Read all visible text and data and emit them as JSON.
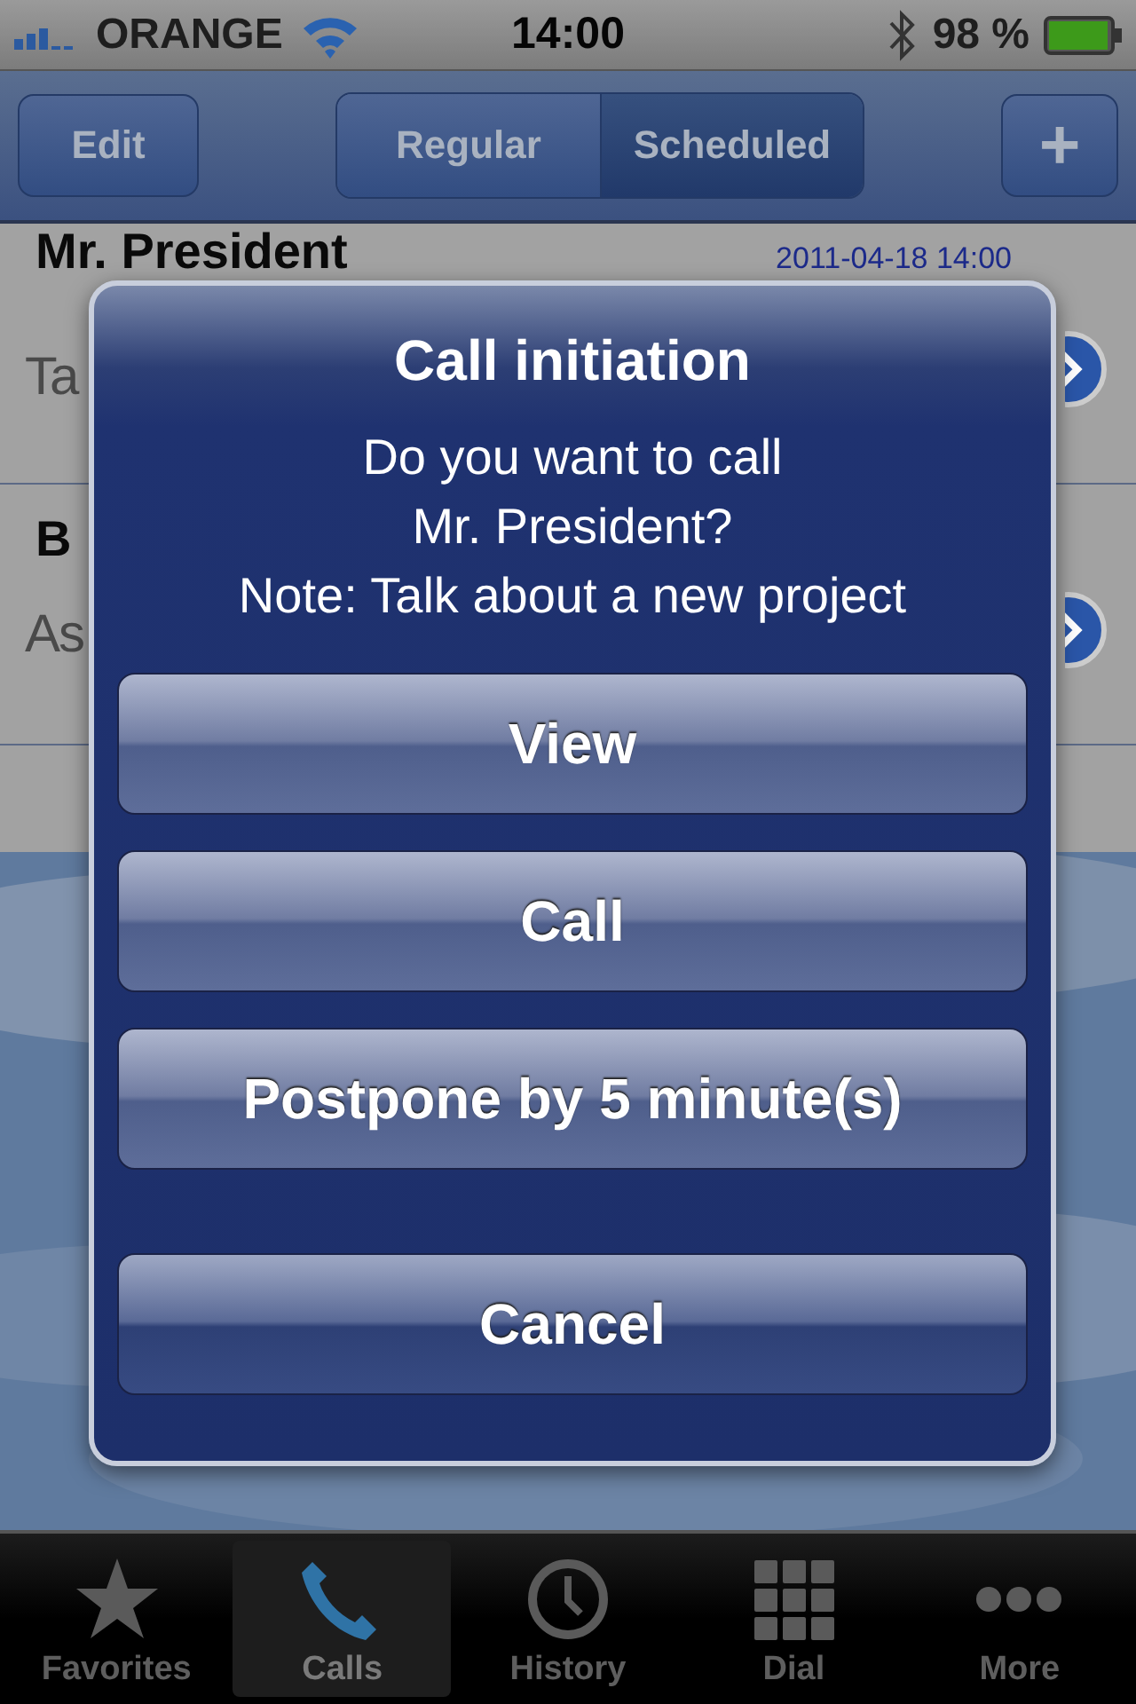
{
  "status_bar": {
    "carrier": "ORANGE",
    "time": "14:00",
    "battery": "98 %"
  },
  "nav_bar": {
    "edit": "Edit",
    "add": "+",
    "segments": [
      {
        "label": "Regular",
        "selected": false
      },
      {
        "label": "Scheduled",
        "selected": true
      }
    ]
  },
  "calls": [
    {
      "name": "Mr. President",
      "date": "2011-04-18 14:00",
      "note": "Ta"
    },
    {
      "name": "B",
      "note": "As"
    }
  ],
  "alert": {
    "title": "Call initiation",
    "message_lines": [
      "Do you want to call",
      "Mr. President?",
      "Note: Talk about a new project"
    ],
    "buttons": [
      {
        "label": "View",
        "kind": "default"
      },
      {
        "label": "Call",
        "kind": "default"
      },
      {
        "label": "Postpone by 5 minute(s)",
        "kind": "default"
      },
      {
        "label": "Cancel",
        "kind": "cancel"
      }
    ]
  },
  "tabs": [
    {
      "label": "Favorites",
      "selected": false
    },
    {
      "label": "Calls",
      "selected": true
    },
    {
      "label": "History",
      "selected": false
    },
    {
      "label": "Dial",
      "selected": false
    },
    {
      "label": "More",
      "selected": false
    }
  ]
}
